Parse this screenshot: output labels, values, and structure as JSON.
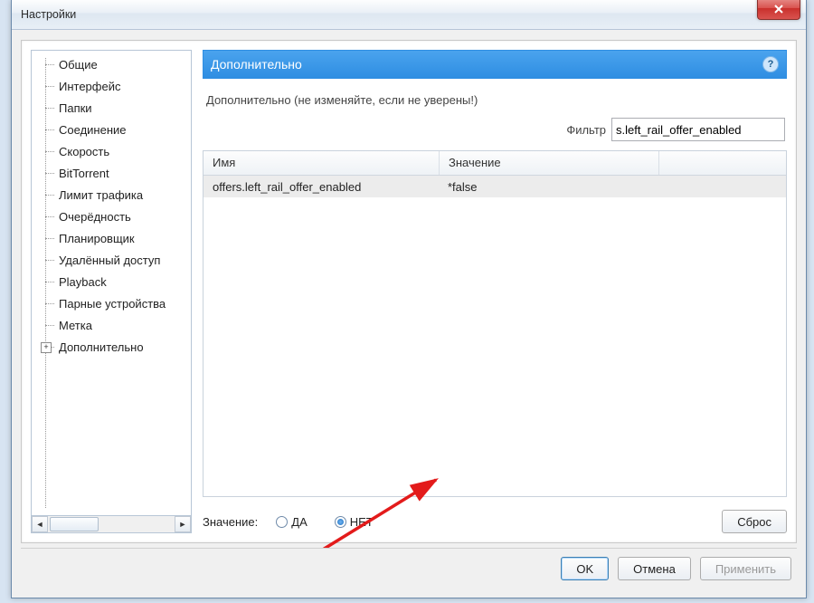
{
  "window": {
    "title": "Настройки",
    "close_icon": "close"
  },
  "tree": {
    "items": [
      {
        "label": "Общие"
      },
      {
        "label": "Интерфейс"
      },
      {
        "label": "Папки"
      },
      {
        "label": "Соединение"
      },
      {
        "label": "Скорость"
      },
      {
        "label": "BitTorrent"
      },
      {
        "label": "Лимит трафика"
      },
      {
        "label": "Очерёдность"
      },
      {
        "label": "Планировщик"
      },
      {
        "label": "Удалённый доступ"
      },
      {
        "label": "Playback"
      },
      {
        "label": "Парные устройства"
      },
      {
        "label": "Метка"
      },
      {
        "label": "Дополнительно",
        "expander": "+"
      }
    ]
  },
  "pane": {
    "title": "Дополнительно",
    "help": "?",
    "subtext": "Дополнительно (не изменяйте, если не уверены!)",
    "filter_label": "Фильтр",
    "filter_value": "s.left_rail_offer_enabled",
    "columns": {
      "c1": "Имя",
      "c2": "Значение"
    },
    "rows": [
      {
        "name": "offers.left_rail_offer_enabled",
        "value": "*false"
      }
    ],
    "value_label": "Значение:",
    "radio_yes": "ДА",
    "radio_no": "НЕТ",
    "selected_radio": "no",
    "reset_label": "Сброс"
  },
  "footer": {
    "ok": "OK",
    "cancel": "Отмена",
    "apply": "Применить"
  }
}
